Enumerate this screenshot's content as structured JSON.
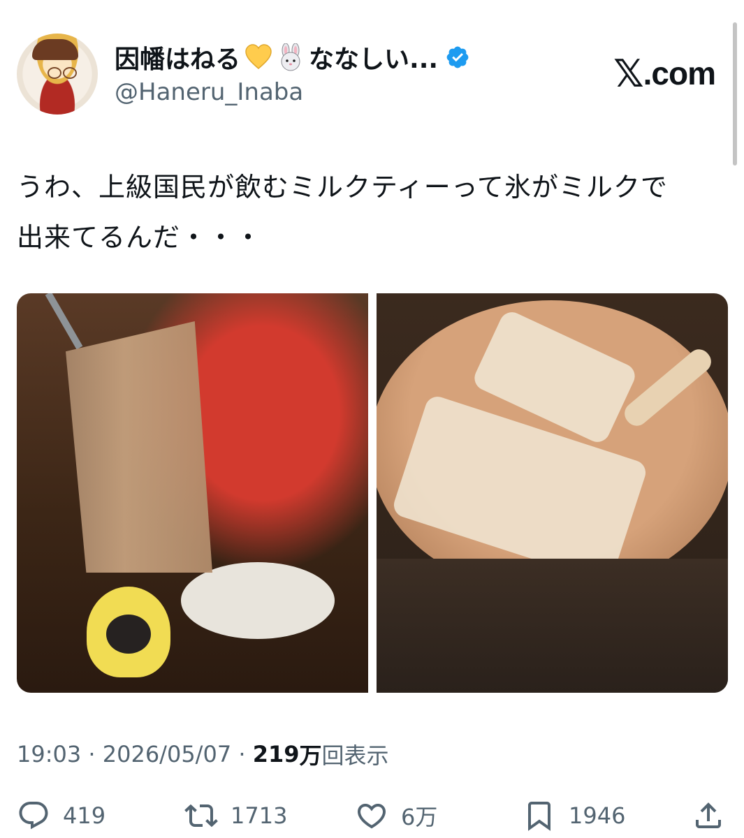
{
  "author": {
    "display_name": "因幡はねる",
    "display_name_suffix": "ななしい...",
    "handle": "@Haneru_Inaba",
    "verified": true,
    "heart_emoji": "💛",
    "rabbit_emoji": "🐰"
  },
  "brand": {
    "label": ".com",
    "x_mark": "𝕏"
  },
  "tweet": {
    "line1": "うわ、上級国民が飲むミルクティーって氷がミルクで",
    "line2": "出来てるんだ・・・"
  },
  "meta": {
    "time": "19:03",
    "separator": " · ",
    "date": "2026/05/07",
    "views_count": "219",
    "views_unit": "万",
    "views_label": "回表示"
  },
  "actions": {
    "reply_count": "419",
    "retweet_count": "1713",
    "like_count": "6万",
    "bookmark_count": "1946"
  },
  "colors": {
    "text": "#0f1419",
    "secondary": "#536471",
    "verified": "#1d9bf0",
    "heart": "#ffcc4d"
  }
}
